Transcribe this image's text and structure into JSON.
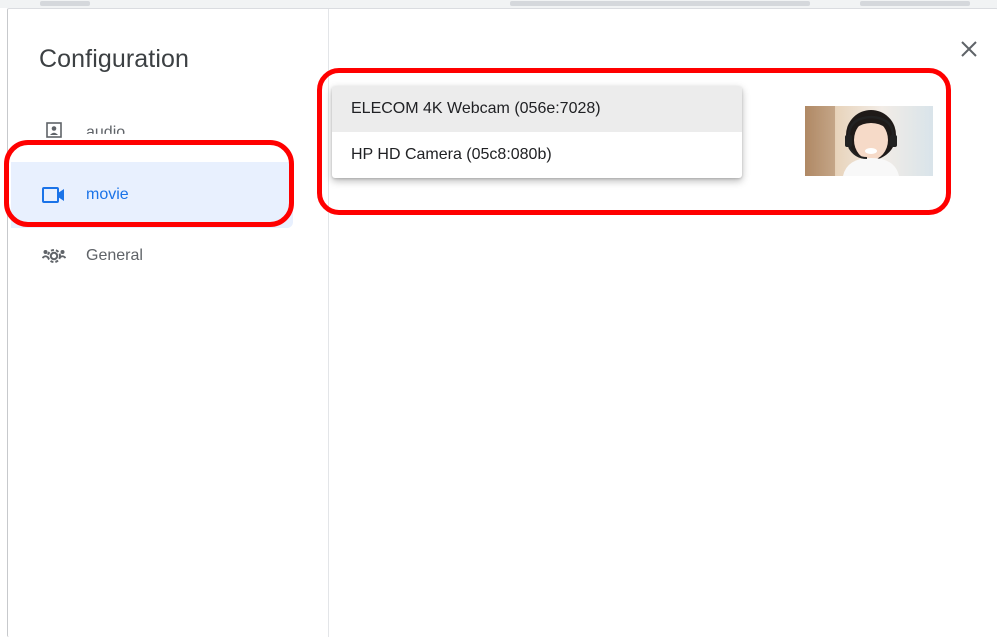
{
  "dialog": {
    "title": "Configuration",
    "close_icon": "close-icon"
  },
  "nav": {
    "items": [
      {
        "label": "audio",
        "icon": "audio-icon",
        "selected": false
      },
      {
        "label": "movie",
        "icon": "video-camera-icon",
        "selected": true
      },
      {
        "label": "General",
        "icon": "people-settings-icon",
        "selected": false
      }
    ]
  },
  "camera_menu": {
    "options": [
      {
        "label": "ELECOM 4K Webcam (056e:7028)",
        "highlighted": true
      },
      {
        "label": "HP HD Camera (05c8:080b)",
        "highlighted": false
      }
    ]
  },
  "preview": {
    "icon": "camera-preview-thumbnail"
  },
  "colors": {
    "accent": "#1a73e8",
    "selected_bg": "#e8f0fe",
    "annotation": "#ff0000"
  }
}
